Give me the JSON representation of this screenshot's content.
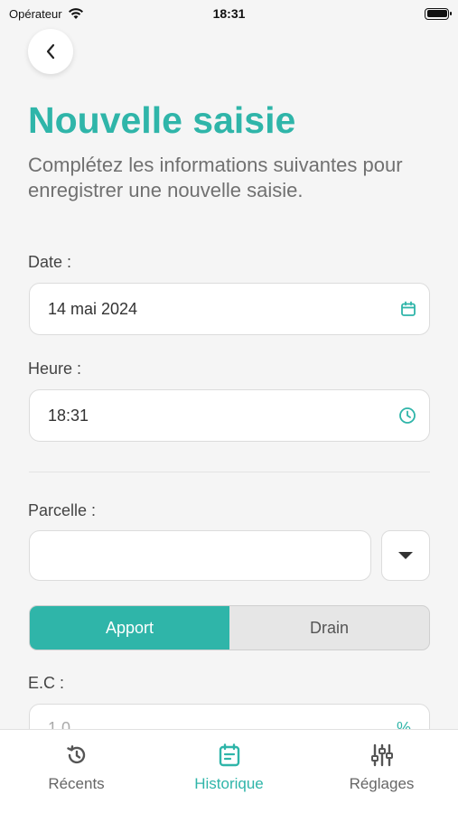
{
  "status_bar": {
    "carrier": "Opérateur",
    "time": "18:31"
  },
  "header": {
    "title": "Nouvelle saisie",
    "subtitle": "Complétez les informations suivantes pour enregistrer une nouvelle saisie."
  },
  "form": {
    "date": {
      "label": "Date :",
      "value": "14 mai 2024",
      "icon": "calendar-icon"
    },
    "time": {
      "label": "Heure :",
      "value": "18:31",
      "icon": "clock-icon"
    },
    "parcel": {
      "label": "Parcelle :",
      "value": "",
      "icon": "caret-down-icon"
    },
    "type_toggle": {
      "options": [
        "Apport",
        "Drain"
      ],
      "selected": "Apport"
    },
    "ec": {
      "label": "E.C :",
      "value": "1,0",
      "unit": "%"
    }
  },
  "tabbar": {
    "items": [
      {
        "label": "Récents",
        "icon": "history-icon",
        "active": false
      },
      {
        "label": "Historique",
        "icon": "list-calendar-icon",
        "active": true
      },
      {
        "label": "Réglages",
        "icon": "sliders-icon",
        "active": false
      }
    ]
  },
  "colors": {
    "accent": "#2fb5a9"
  }
}
